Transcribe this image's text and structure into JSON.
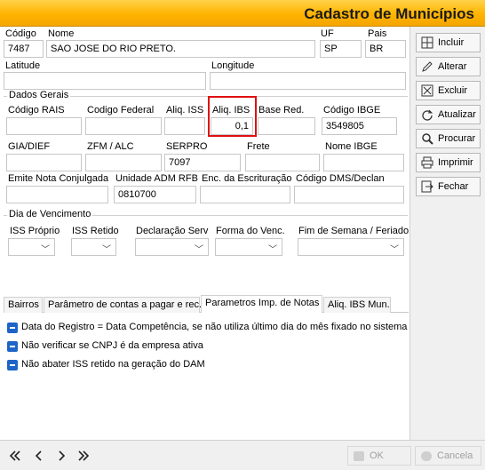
{
  "window": {
    "title": "Cadastro de Municípios"
  },
  "fields": {
    "codigo": {
      "label": "Código",
      "value": "7487"
    },
    "nome": {
      "label": "Nome",
      "value": "SAO JOSE DO RIO PRETO."
    },
    "uf": {
      "label": "UF",
      "value": "SP"
    },
    "pais": {
      "label": "Pais",
      "value": "BR"
    },
    "latitude": {
      "label": "Latitude",
      "value": ""
    },
    "longitude": {
      "label": "Longitude",
      "value": ""
    }
  },
  "dados_gerais": {
    "title": "Dados Gerais",
    "codigo_rais": {
      "label": "Código RAIS",
      "value": ""
    },
    "codigo_federal": {
      "label": "Codigo Federal",
      "value": ""
    },
    "aliq_iss": {
      "label": "Aliq. ISS",
      "value": ""
    },
    "aliq_ibs": {
      "label": "Aliq. IBS",
      "value": "0,1"
    },
    "base_red": {
      "label": "Base Red.",
      "value": ""
    },
    "codigo_ibge": {
      "label": "Código IBGE",
      "value": "3549805"
    },
    "gia_dief": {
      "label": "GIA/DIEF",
      "value": ""
    },
    "zfm_alc": {
      "label": "ZFM / ALC",
      "value": ""
    },
    "serpro": {
      "label": "SERPRO",
      "value": "7097"
    },
    "frete": {
      "label": "Frete",
      "value": ""
    },
    "nome_ibge": {
      "label": "Nome IBGE",
      "value": ""
    },
    "emite_nota": {
      "label": "Emite Nota Conjulgada",
      "value": ""
    },
    "unidade_adm_rfb": {
      "label": "Unidade ADM RFB",
      "value": "0810700"
    },
    "enc_escrituracao": {
      "label": "Enc. da Escrituração",
      "value": ""
    },
    "codigo_dms": {
      "label": "Código DMS/Declan",
      "value": ""
    }
  },
  "dia_vencimento": {
    "title": "Dia de Vencimento",
    "iss_proprio": {
      "label": "ISS Próprio",
      "value": ""
    },
    "iss_retido": {
      "label": "ISS Retido",
      "value": ""
    },
    "declaracao_serv": {
      "label": "Declaração Serv",
      "value": ""
    },
    "forma_venc": {
      "label": "Forma do Venc.",
      "value": ""
    },
    "fim_semana": {
      "label": "Fim de Semana / Feriado",
      "value": ""
    }
  },
  "tabs": [
    {
      "label": "Bairros"
    },
    {
      "label": "Parâmetro de contas a pagar e rec."
    },
    {
      "label": "Parametros Imp. de Notas"
    },
    {
      "label": "Aliq. IBS Mun."
    }
  ],
  "options": [
    {
      "label": "Data do Registro = Data Competência, se não utiliza último dia do mês fixado no sistema"
    },
    {
      "label": "Não verificar se CNPJ é da empresa ativa"
    },
    {
      "label": "Não abater ISS retido na geração do DAM"
    }
  ],
  "actions": {
    "incluir": "Incluir",
    "alterar": "Alterar",
    "excluir": "Excluir",
    "atualizar": "Atualizar",
    "procurar": "Procurar",
    "imprimir": "Imprimir",
    "fechar": "Fechar"
  },
  "footer": {
    "ok": "OK",
    "cancela": "Cancela"
  },
  "colors": {
    "titlebar": "#ffb400",
    "checkbox": "#1e64c8",
    "highlight": "#e01010"
  }
}
